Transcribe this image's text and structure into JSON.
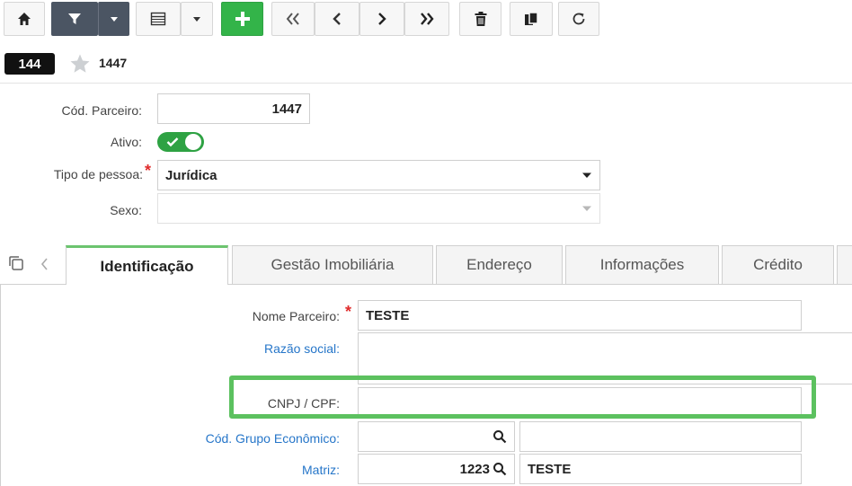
{
  "record": {
    "badge": "144",
    "id": "1447"
  },
  "form": {
    "cod_parceiro": {
      "label": "Cód. Parceiro:",
      "value": "1447"
    },
    "ativo": {
      "label": "Ativo:",
      "checked": true
    },
    "tipo_pessoa": {
      "label": "Tipo de pessoa:",
      "value": "Jurídica"
    },
    "sexo": {
      "label": "Sexo:",
      "value": ""
    }
  },
  "tabs": [
    {
      "label": "Identificação"
    },
    {
      "label": "Gestão Imobiliária"
    },
    {
      "label": "Endereço"
    },
    {
      "label": "Informações"
    },
    {
      "label": "Crédito"
    }
  ],
  "identificacao": {
    "nome_parceiro": {
      "label": "Nome Parceiro:",
      "value": "TESTE"
    },
    "razao_social": {
      "label": "Razão social:",
      "value": ""
    },
    "cnpj_cpf": {
      "label": "CNPJ / CPF:",
      "value": ""
    },
    "grupo_economico": {
      "label": "Cód. Grupo Econômico:",
      "value": "",
      "desc": ""
    },
    "matriz": {
      "label": "Matriz:",
      "value": "1223",
      "desc": "TESTE"
    }
  },
  "colors": {
    "accent_green": "#33b449",
    "highlight": "#5cc15f",
    "link_blue": "#2676c9",
    "required": "#e02b2b"
  }
}
